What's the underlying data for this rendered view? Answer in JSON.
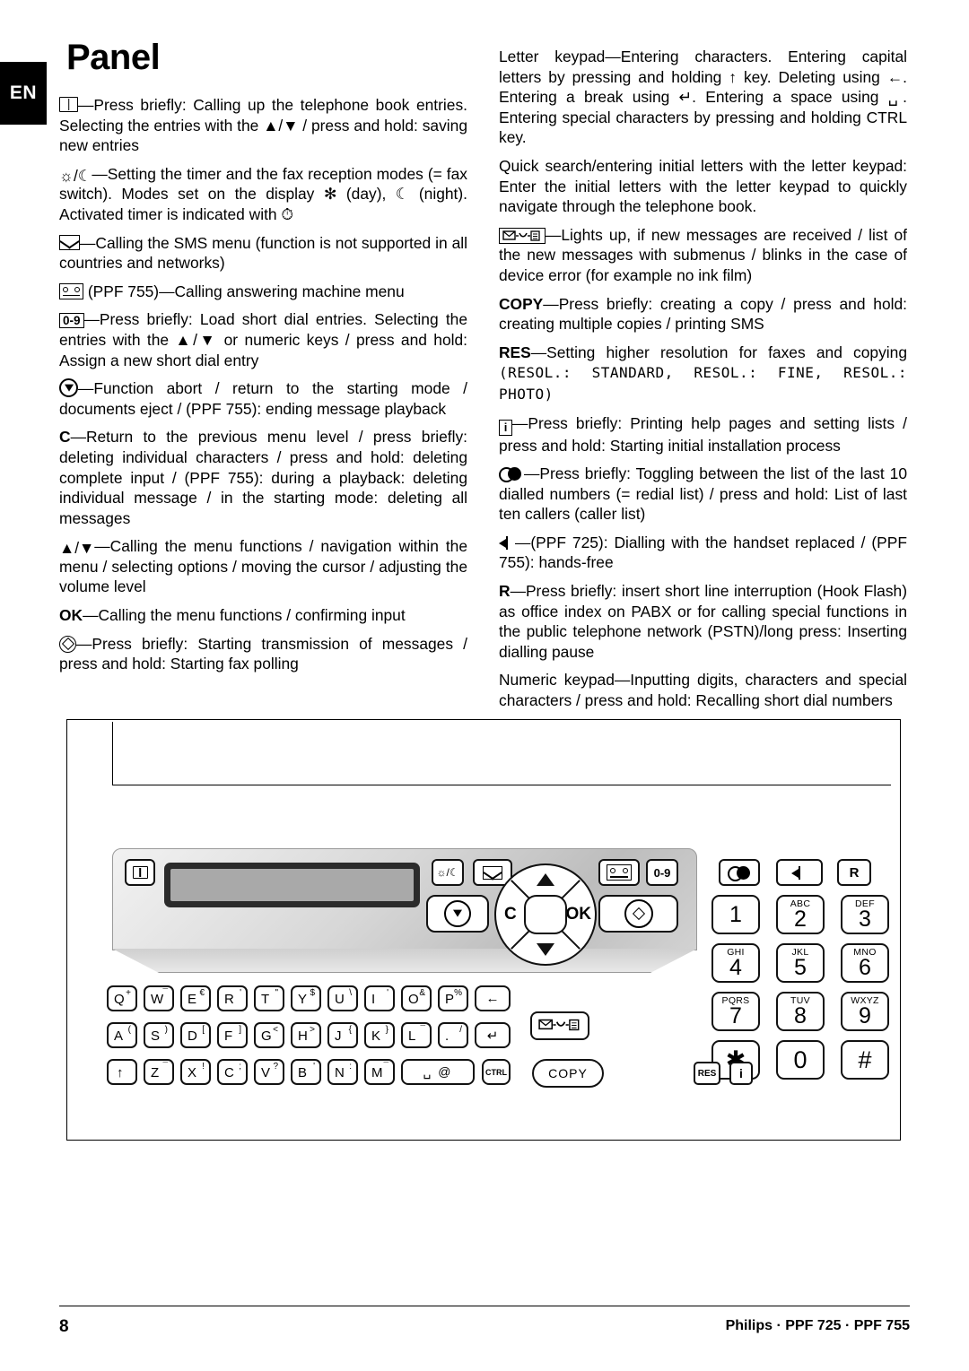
{
  "lang_tab": "EN",
  "title": "Panel",
  "left_column": [
    {
      "icon": "phonebook-icon",
      "text": "—Press briefly: Calling up the telephone book entries. Selecting the entries with the ▲/▼ / press and hold: saving new entries"
    },
    {
      "icon": "sun-moon-icon",
      "text": "—Setting the timer and the fax reception modes (= fax switch). Modes set on the display ✻ (day), ☾ (night). Activated timer is indicated with ⏱"
    },
    {
      "icon": "envelope-icon",
      "text": "—Calling the SMS menu (function is not supported in all countries and networks)"
    },
    {
      "icon": "answering-machine-icon",
      "text": " (PPF 755)—Calling answering machine menu"
    },
    {
      "icon": "zero-to-nine-icon",
      "text": "—Press briefly: Load short dial entries. Selecting the entries with the ▲/▼ or numeric keys / press and hold: Assign a new short dial entry"
    },
    {
      "icon": "stop-icon",
      "text": "—Function abort / return to the starting mode / documents eject / (PPF 755): ending message playback"
    },
    {
      "icon": "c-key",
      "text": "—Return to the previous menu level / press briefly: deleting individual characters / press and hold: deleting complete input / (PPF 755): during a playback: deleting individual message / in the starting mode: deleting all messages"
    },
    {
      "icon": "up-down-arrows-icon",
      "text": "—Calling the menu functions / navigation within the menu / selecting options / moving the cursor / adjusting the volume level"
    },
    {
      "icon": "ok-key",
      "text": "—Calling the menu functions / confirming input"
    },
    {
      "icon": "start-icon",
      "text": "—Press briefly: Starting transmission of messages / press and hold: Starting fax polling"
    }
  ],
  "right_column": [
    {
      "lead": "Letter keypad",
      "text": "—Entering characters. Entering capital letters by pressing and holding ↑ key. Deleting using ←. Entering a break using ↵. Entering a space using ␣. Entering special characters by pressing and holding CTRL key."
    },
    {
      "lead": "",
      "text": "Quick search/entering initial letters with the letter keypad: Enter the initial letters with the letter keypad to quickly navigate through the telephone book."
    },
    {
      "lead": "",
      "icon": "message-led-icon",
      "text": "—Lights up, if new messages are received / list of the new messages with submenus / blinks in the case of device error (for example no ink film)"
    },
    {
      "lead": "COPY",
      "text": "—Press briefly: creating a copy / press and hold: creating multiple copies / printing SMS"
    },
    {
      "lead": "RES",
      "text": "—Setting higher resolution for faxes and copying",
      "lcd": "(RESOL.: STANDARD, RESOL.: FINE, RESOL.: PHOTO)"
    },
    {
      "lead": "",
      "icon": "info-icon",
      "text": "—Press briefly: Printing help pages and setting lists / press and hold: Starting initial installation process"
    },
    {
      "lead": "",
      "icon": "redial-icon",
      "text": "—Press briefly: Toggling between the list of the last 10 dialled numbers (= redial list) / press and hold: List of last ten callers (caller list)"
    },
    {
      "lead": "",
      "icon": "speaker-icon",
      "text": "—(PPF 725): Dialling with the handset replaced / (PPF 755): hands-free"
    },
    {
      "lead": "R",
      "text": "—Press briefly: insert short line interruption (Hook Flash) as office index on PABX or for calling special functions in the public telephone network (PSTN)/long press: Inserting dialling pause"
    },
    {
      "lead": "Numeric keypad",
      "text": "—Inputting digits, characters and special characters / press and hold: Recalling short dial numbers"
    }
  ],
  "panel": {
    "console_keys": {
      "phonebook": "phonebook-icon",
      "timer": "sun-moon-icon",
      "sms": "envelope-icon",
      "stop": "stop-icon",
      "answering": "answering-machine-icon",
      "shortdial": "0-9",
      "start": "start-icon",
      "nav_c": "C",
      "nav_ok": "OK"
    },
    "right_top_keys": [
      {
        "name": "redial-key",
        "label": "redial-icon"
      },
      {
        "name": "speaker-key",
        "label": "speaker-icon"
      },
      {
        "name": "r-key",
        "label": "R"
      }
    ],
    "numeric_keypad": [
      {
        "digit": "1",
        "letters": ""
      },
      {
        "digit": "2",
        "letters": "ABC"
      },
      {
        "digit": "3",
        "letters": "DEF"
      },
      {
        "digit": "4",
        "letters": "GHI"
      },
      {
        "digit": "5",
        "letters": "JKL"
      },
      {
        "digit": "6",
        "letters": "MNO"
      },
      {
        "digit": "7",
        "letters": "PQRS"
      },
      {
        "digit": "8",
        "letters": "TUV"
      },
      {
        "digit": "9",
        "letters": "WXYZ"
      },
      {
        "digit": "✱",
        "letters": ""
      },
      {
        "digit": "0",
        "letters": ""
      },
      {
        "digit": "#",
        "letters": ""
      }
    ],
    "letter_keypad": {
      "row1": [
        {
          "main": "Q",
          "sup": "+"
        },
        {
          "main": "W",
          "sup": "¯"
        },
        {
          "main": "E",
          "sup": "€"
        },
        {
          "main": "R",
          "sup": "'"
        },
        {
          "main": "T",
          "sup": "\""
        },
        {
          "main": "Y",
          "sup": "$"
        },
        {
          "main": "U",
          "sup": "\\"
        },
        {
          "main": "I",
          "sup": "'"
        },
        {
          "main": "O",
          "sup": "&"
        },
        {
          "main": "P",
          "sup": "%"
        }
      ],
      "row1_special": "←",
      "row2": [
        {
          "main": "A",
          "sup": "("
        },
        {
          "main": "S",
          "sup": ")"
        },
        {
          "main": "D",
          "sup": "["
        },
        {
          "main": "F",
          "sup": "]"
        },
        {
          "main": "G",
          "sup": "<"
        },
        {
          "main": "H",
          "sup": ">"
        },
        {
          "main": "J",
          "sup": "{"
        },
        {
          "main": "K",
          "sup": "}"
        },
        {
          "main": "L",
          "sup": "¯"
        },
        {
          "main": ".",
          "sup": "/"
        }
      ],
      "row2_special": "↵",
      "row3": [
        {
          "main": "↑",
          "sup": ""
        },
        {
          "main": "Z",
          "sup": "¯"
        },
        {
          "main": "X",
          "sup": "!"
        },
        {
          "main": "C",
          "sup": ";"
        },
        {
          "main": "V",
          "sup": "?"
        },
        {
          "main": "B",
          "sup": "'"
        },
        {
          "main": "N",
          "sup": ":"
        },
        {
          "main": "M",
          "sup": "¯"
        }
      ],
      "space_key": "␣  @",
      "ctrl_key": "CTRL"
    },
    "function_keys": {
      "message_led": "message-led-icon",
      "copy": "COPY",
      "res": "RES",
      "info": "i"
    }
  },
  "footer": {
    "page_number": "8",
    "brand": "Philips · PPF 725 · PPF 755"
  }
}
